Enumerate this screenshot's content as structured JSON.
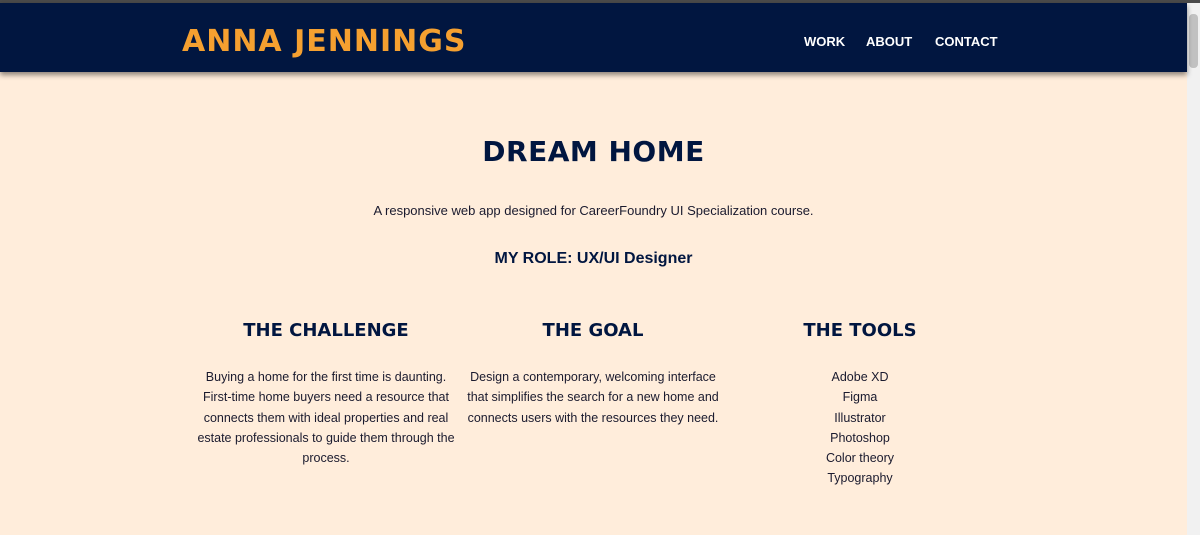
{
  "header": {
    "logo": "ANNA JENNINGS",
    "nav": [
      {
        "label": "WORK"
      },
      {
        "label": "ABOUT"
      },
      {
        "label": "CONTACT"
      }
    ]
  },
  "main": {
    "title": "DREAM HOME",
    "subtitle": "A responsive web app designed for CareerFoundry UI Specialization course.",
    "role": "MY ROLE: UX/UI Designer",
    "challenge": {
      "heading": "THE CHALLENGE",
      "text": "Buying a home for the first time is daunting. First-time home buyers need a resource that connects them with ideal properties and real estate professionals to guide them through the process."
    },
    "goal": {
      "heading": "THE GOAL",
      "text": "Design a contemporary, welcoming interface that simplifies the search for a new home and connects users with the resources they need."
    },
    "tools": {
      "heading": "THE TOOLS",
      "items": [
        "Adobe XD",
        "Figma",
        "Illustrator",
        "Photoshop",
        "Color theory",
        "Typography"
      ]
    }
  },
  "colors": {
    "navy": "#011640",
    "accent_orange": "#f5a030",
    "background": "#ffeddb"
  }
}
